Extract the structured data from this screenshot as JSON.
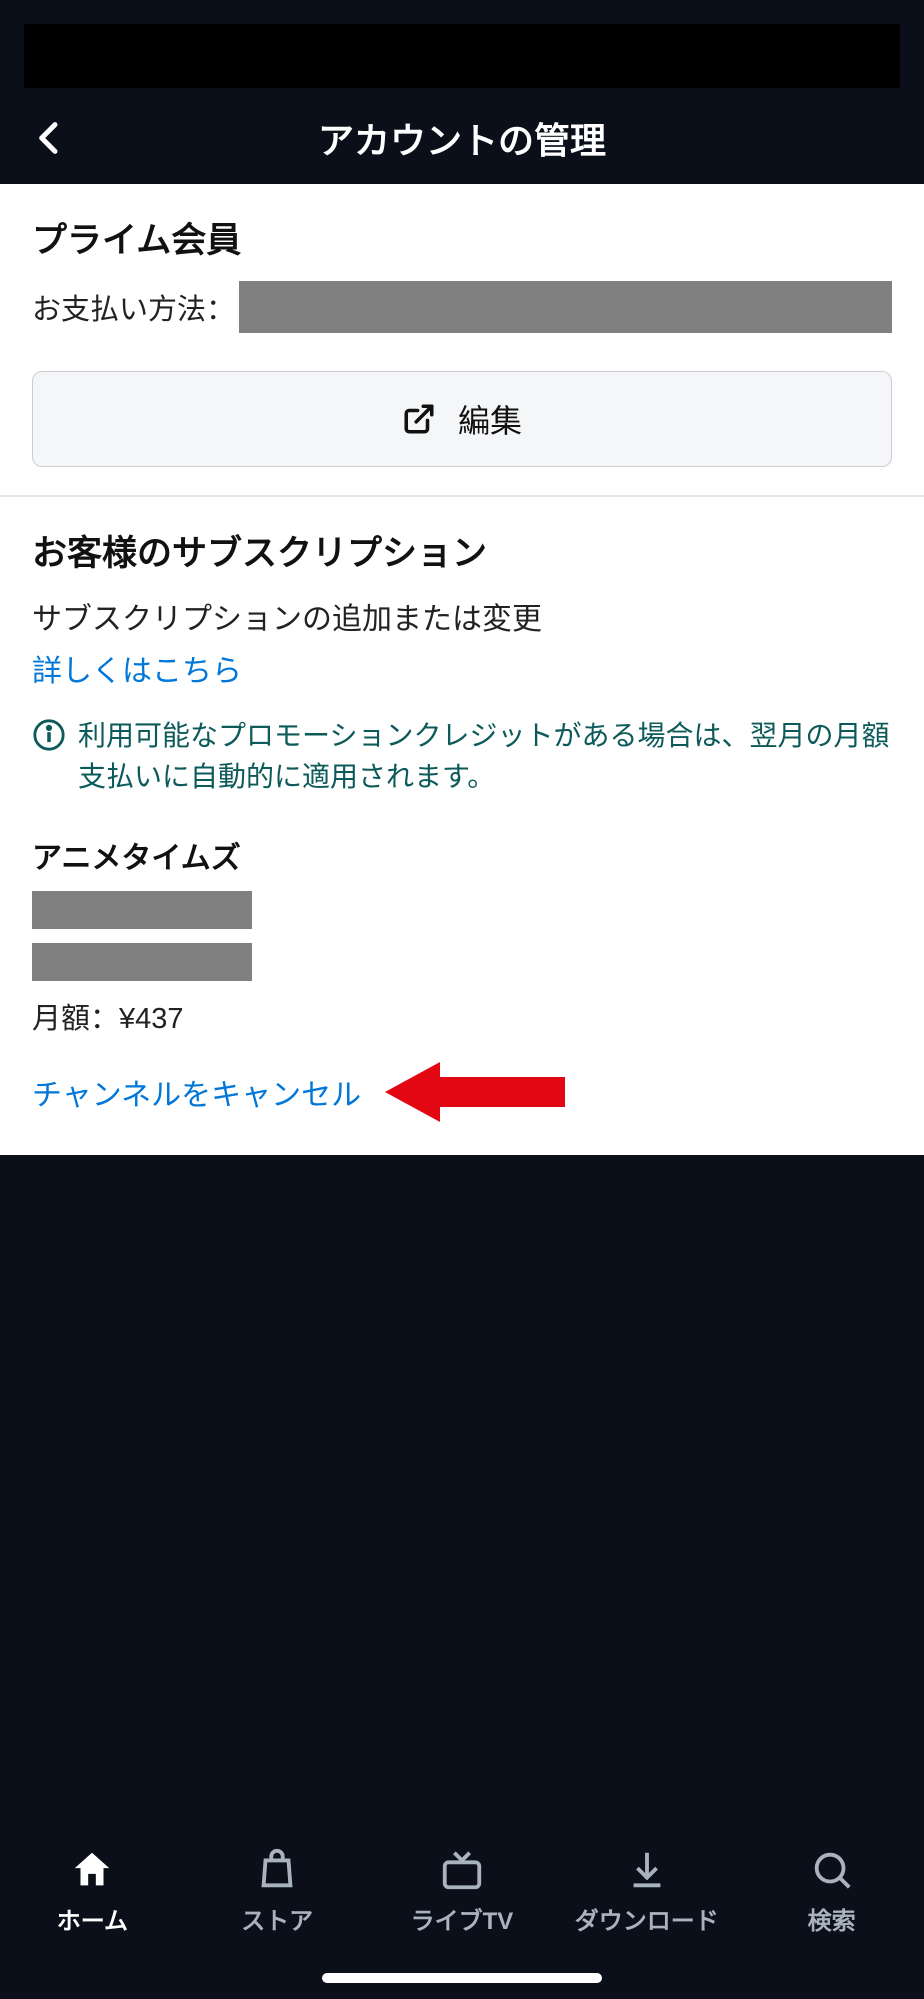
{
  "header": {
    "title": "アカウントの管理"
  },
  "prime": {
    "section_title": "プライム会員",
    "payment_label": "お支払い方法：",
    "edit_label": "編集"
  },
  "subscriptions": {
    "section_title": "お客様のサブスクリプション",
    "description": "サブスクリプションの追加または変更",
    "learn_more": "詳しくはこちら",
    "info_text": "利用可能なプロモーションクレジットがある場合は、翌月の月額支払いに自動的に適用されます。"
  },
  "channel": {
    "name": "アニメタイムズ",
    "price_label": "月額：",
    "price_value": "¥437",
    "cancel_label": "チャンネルをキャンセル"
  },
  "nav": {
    "home": "ホーム",
    "store": "ストア",
    "livetv": "ライブTV",
    "download": "ダウンロード",
    "search": "検索"
  }
}
